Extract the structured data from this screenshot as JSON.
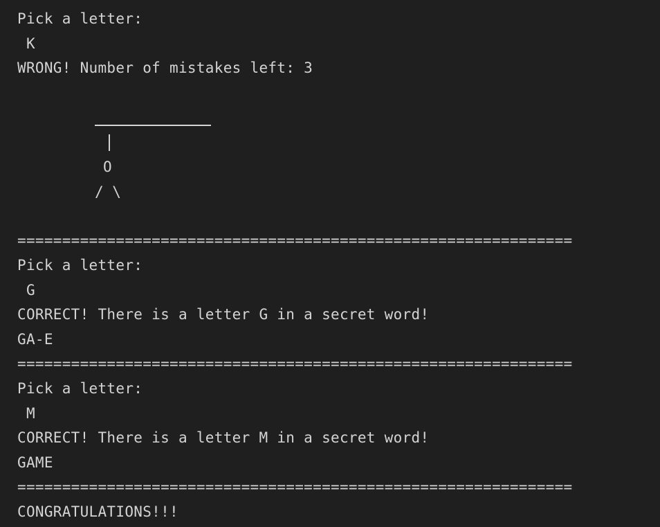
{
  "terminal": {
    "round1": {
      "prompt": "Pick a letter:",
      "input": " K",
      "result": "WRONG! Number of mistakes left: 3"
    },
    "hangman": {
      "head": "O",
      "arms": "/ \\"
    },
    "separator": "==============================================================",
    "round2": {
      "prompt": "Pick a letter:",
      "input": " G",
      "result": "CORRECT! There is a letter G in a secret word!",
      "word": "GA-E"
    },
    "round3": {
      "prompt": "Pick a letter:",
      "input": " M",
      "result": "CORRECT! There is a letter M in a secret word!",
      "word": "GAME"
    },
    "final": "CONGRATULATIONS!!!"
  }
}
